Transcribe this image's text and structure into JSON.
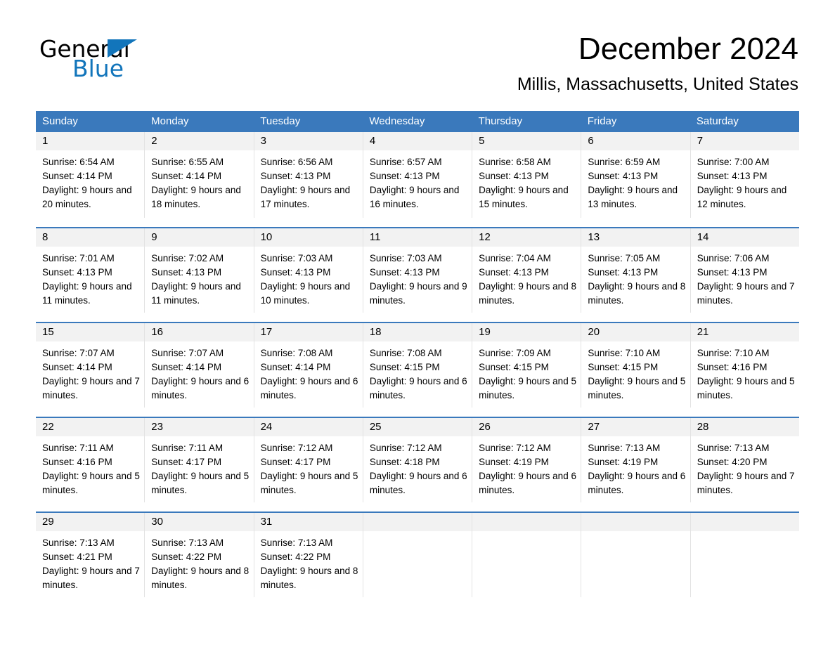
{
  "brand": {
    "name_top": "General",
    "name_bottom": "Blue",
    "accent_color": "#1275bb"
  },
  "header": {
    "month_title": "December 2024",
    "location": "Millis, Massachusetts, United States"
  },
  "theme": {
    "header_row_color": "#3a79bc",
    "daynum_band_color": "#f2f2f2",
    "week_divider_color": "#3a79bc",
    "text_color": "#000000"
  },
  "weekday_headers": [
    "Sunday",
    "Monday",
    "Tuesday",
    "Wednesday",
    "Thursday",
    "Friday",
    "Saturday"
  ],
  "weeks": [
    {
      "days": [
        {
          "day": "1",
          "sunrise": "Sunrise: 6:54 AM",
          "sunset": "Sunset: 4:14 PM",
          "daylight": "Daylight: 9 hours and 20 minutes."
        },
        {
          "day": "2",
          "sunrise": "Sunrise: 6:55 AM",
          "sunset": "Sunset: 4:14 PM",
          "daylight": "Daylight: 9 hours and 18 minutes."
        },
        {
          "day": "3",
          "sunrise": "Sunrise: 6:56 AM",
          "sunset": "Sunset: 4:13 PM",
          "daylight": "Daylight: 9 hours and 17 minutes."
        },
        {
          "day": "4",
          "sunrise": "Sunrise: 6:57 AM",
          "sunset": "Sunset: 4:13 PM",
          "daylight": "Daylight: 9 hours and 16 minutes."
        },
        {
          "day": "5",
          "sunrise": "Sunrise: 6:58 AM",
          "sunset": "Sunset: 4:13 PM",
          "daylight": "Daylight: 9 hours and 15 minutes."
        },
        {
          "day": "6",
          "sunrise": "Sunrise: 6:59 AM",
          "sunset": "Sunset: 4:13 PM",
          "daylight": "Daylight: 9 hours and 13 minutes."
        },
        {
          "day": "7",
          "sunrise": "Sunrise: 7:00 AM",
          "sunset": "Sunset: 4:13 PM",
          "daylight": "Daylight: 9 hours and 12 minutes."
        }
      ]
    },
    {
      "days": [
        {
          "day": "8",
          "sunrise": "Sunrise: 7:01 AM",
          "sunset": "Sunset: 4:13 PM",
          "daylight": "Daylight: 9 hours and 11 minutes."
        },
        {
          "day": "9",
          "sunrise": "Sunrise: 7:02 AM",
          "sunset": "Sunset: 4:13 PM",
          "daylight": "Daylight: 9 hours and 11 minutes."
        },
        {
          "day": "10",
          "sunrise": "Sunrise: 7:03 AM",
          "sunset": "Sunset: 4:13 PM",
          "daylight": "Daylight: 9 hours and 10 minutes."
        },
        {
          "day": "11",
          "sunrise": "Sunrise: 7:03 AM",
          "sunset": "Sunset: 4:13 PM",
          "daylight": "Daylight: 9 hours and 9 minutes."
        },
        {
          "day": "12",
          "sunrise": "Sunrise: 7:04 AM",
          "sunset": "Sunset: 4:13 PM",
          "daylight": "Daylight: 9 hours and 8 minutes."
        },
        {
          "day": "13",
          "sunrise": "Sunrise: 7:05 AM",
          "sunset": "Sunset: 4:13 PM",
          "daylight": "Daylight: 9 hours and 8 minutes."
        },
        {
          "day": "14",
          "sunrise": "Sunrise: 7:06 AM",
          "sunset": "Sunset: 4:13 PM",
          "daylight": "Daylight: 9 hours and 7 minutes."
        }
      ]
    },
    {
      "days": [
        {
          "day": "15",
          "sunrise": "Sunrise: 7:07 AM",
          "sunset": "Sunset: 4:14 PM",
          "daylight": "Daylight: 9 hours and 7 minutes."
        },
        {
          "day": "16",
          "sunrise": "Sunrise: 7:07 AM",
          "sunset": "Sunset: 4:14 PM",
          "daylight": "Daylight: 9 hours and 6 minutes."
        },
        {
          "day": "17",
          "sunrise": "Sunrise: 7:08 AM",
          "sunset": "Sunset: 4:14 PM",
          "daylight": "Daylight: 9 hours and 6 minutes."
        },
        {
          "day": "18",
          "sunrise": "Sunrise: 7:08 AM",
          "sunset": "Sunset: 4:15 PM",
          "daylight": "Daylight: 9 hours and 6 minutes."
        },
        {
          "day": "19",
          "sunrise": "Sunrise: 7:09 AM",
          "sunset": "Sunset: 4:15 PM",
          "daylight": "Daylight: 9 hours and 5 minutes."
        },
        {
          "day": "20",
          "sunrise": "Sunrise: 7:10 AM",
          "sunset": "Sunset: 4:15 PM",
          "daylight": "Daylight: 9 hours and 5 minutes."
        },
        {
          "day": "21",
          "sunrise": "Sunrise: 7:10 AM",
          "sunset": "Sunset: 4:16 PM",
          "daylight": "Daylight: 9 hours and 5 minutes."
        }
      ]
    },
    {
      "days": [
        {
          "day": "22",
          "sunrise": "Sunrise: 7:11 AM",
          "sunset": "Sunset: 4:16 PM",
          "daylight": "Daylight: 9 hours and 5 minutes."
        },
        {
          "day": "23",
          "sunrise": "Sunrise: 7:11 AM",
          "sunset": "Sunset: 4:17 PM",
          "daylight": "Daylight: 9 hours and 5 minutes."
        },
        {
          "day": "24",
          "sunrise": "Sunrise: 7:12 AM",
          "sunset": "Sunset: 4:17 PM",
          "daylight": "Daylight: 9 hours and 5 minutes."
        },
        {
          "day": "25",
          "sunrise": "Sunrise: 7:12 AM",
          "sunset": "Sunset: 4:18 PM",
          "daylight": "Daylight: 9 hours and 6 minutes."
        },
        {
          "day": "26",
          "sunrise": "Sunrise: 7:12 AM",
          "sunset": "Sunset: 4:19 PM",
          "daylight": "Daylight: 9 hours and 6 minutes."
        },
        {
          "day": "27",
          "sunrise": "Sunrise: 7:13 AM",
          "sunset": "Sunset: 4:19 PM",
          "daylight": "Daylight: 9 hours and 6 minutes."
        },
        {
          "day": "28",
          "sunrise": "Sunrise: 7:13 AM",
          "sunset": "Sunset: 4:20 PM",
          "daylight": "Daylight: 9 hours and 7 minutes."
        }
      ]
    },
    {
      "days": [
        {
          "day": "29",
          "sunrise": "Sunrise: 7:13 AM",
          "sunset": "Sunset: 4:21 PM",
          "daylight": "Daylight: 9 hours and 7 minutes."
        },
        {
          "day": "30",
          "sunrise": "Sunrise: 7:13 AM",
          "sunset": "Sunset: 4:22 PM",
          "daylight": "Daylight: 9 hours and 8 minutes."
        },
        {
          "day": "31",
          "sunrise": "Sunrise: 7:13 AM",
          "sunset": "Sunset: 4:22 PM",
          "daylight": "Daylight: 9 hours and 8 minutes."
        },
        {
          "day": "",
          "sunrise": "",
          "sunset": "",
          "daylight": ""
        },
        {
          "day": "",
          "sunrise": "",
          "sunset": "",
          "daylight": ""
        },
        {
          "day": "",
          "sunrise": "",
          "sunset": "",
          "daylight": ""
        },
        {
          "day": "",
          "sunrise": "",
          "sunset": "",
          "daylight": ""
        }
      ]
    }
  ]
}
